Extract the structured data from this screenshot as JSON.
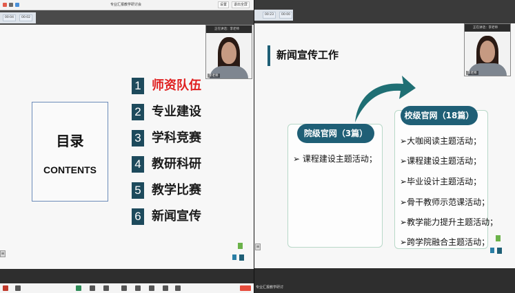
{
  "left": {
    "window_title": "专业汇报教学研讨会",
    "window_buttons": [
      "设置",
      "退出全屏"
    ],
    "control_pills": [
      "00:04",
      "00:02"
    ],
    "slide": {
      "toc_title": "目录",
      "toc_subtitle": "CONTENTS",
      "items": [
        {
          "num": "1",
          "label": "师资队伍",
          "active": true
        },
        {
          "num": "2",
          "label": "专业建设",
          "active": false
        },
        {
          "num": "3",
          "label": "学科竞赛",
          "active": false
        },
        {
          "num": "4",
          "label": "教研科研",
          "active": false
        },
        {
          "num": "5",
          "label": "教学比赛",
          "active": false
        },
        {
          "num": "6",
          "label": "新闻宣传",
          "active": false
        }
      ]
    },
    "webcam": {
      "header": "正在讲话：李老师",
      "name": "李老师"
    }
  },
  "right": {
    "control_pills": [
      "00:23",
      "00:00"
    ],
    "slide": {
      "title": "新闻宣传工作",
      "college_card": {
        "header": "院级官网（3篇）",
        "bullets": [
          "课程建设主题活动；"
        ]
      },
      "school_card": {
        "header": "校级官网（18篇）",
        "bullets": [
          "大咖阅读主题活动；",
          "课程建设主题活动；",
          "毕业设计主题活动；",
          "骨干教师示范课活动；",
          "教学能力提升主题活动；",
          "跨学院融合主题活动；"
        ]
      }
    },
    "webcam": {
      "header": "正在讲话：李老师",
      "name": "李老师"
    },
    "bottom_label": "专业汇报教学研讨"
  },
  "colors": {
    "accent_teal": "#1f5f76",
    "active_red": "#e02020",
    "deco_green": "#6bb24a",
    "deco_blue": "#2a7fa6"
  },
  "icons": {
    "arrow": "curved-arrow-icon",
    "bullet": "triangle-bullet-icon"
  }
}
